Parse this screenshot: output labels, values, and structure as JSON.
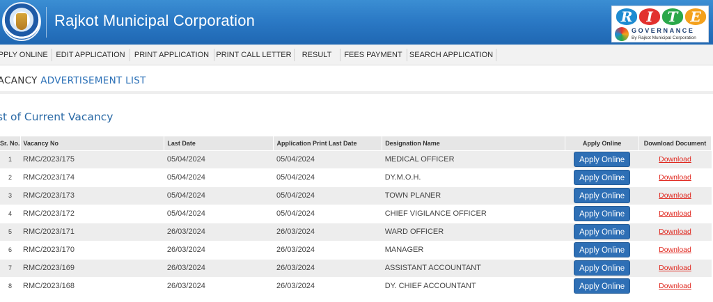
{
  "header": {
    "title": "Rajkot Municipal Corporation",
    "logo_name": "rmc-emblem",
    "rite": {
      "letters": [
        "R",
        "I",
        "T",
        "E"
      ],
      "governance": "GOVERNANCE",
      "by": "By Rajkot Municipal Corporation"
    }
  },
  "nav": {
    "items": [
      "APPLY ONLINE",
      "EDIT APPLICATION",
      "PRINT APPLICATION",
      "PRINT CALL LETTER",
      "RESULT",
      "FEES PAYMENT",
      "SEARCH APPLICATION"
    ]
  },
  "band": {
    "prefix": "VACANCY ",
    "highlight": "ADVERTISEMENT LIST"
  },
  "section_title": "List of Current Vacancy",
  "table": {
    "headers": [
      "Sr. No.",
      "Vacancy No",
      "Last Date",
      "Application Print Last Date",
      "Designation Name",
      "Apply Online",
      "Download Document"
    ],
    "button_label": "Apply Online",
    "download_label": "Download",
    "rows": [
      {
        "sr": "1",
        "vacancy": "RMC/2023/175",
        "last_date": "05/04/2024",
        "print_last_date": "05/04/2024",
        "designation": "MEDICAL OFFICER"
      },
      {
        "sr": "2",
        "vacancy": "RMC/2023/174",
        "last_date": "05/04/2024",
        "print_last_date": "05/04/2024",
        "designation": "DY.M.O.H."
      },
      {
        "sr": "3",
        "vacancy": "RMC/2023/173",
        "last_date": "05/04/2024",
        "print_last_date": "05/04/2024",
        "designation": "TOWN PLANER"
      },
      {
        "sr": "4",
        "vacancy": "RMC/2023/172",
        "last_date": "05/04/2024",
        "print_last_date": "05/04/2024",
        "designation": "CHIEF VIGILANCE OFFICER"
      },
      {
        "sr": "5",
        "vacancy": "RMC/2023/171",
        "last_date": "26/03/2024",
        "print_last_date": "26/03/2024",
        "designation": "WARD OFFICER"
      },
      {
        "sr": "6",
        "vacancy": "RMC/2023/170",
        "last_date": "26/03/2024",
        "print_last_date": "26/03/2024",
        "designation": "MANAGER"
      },
      {
        "sr": "7",
        "vacancy": "RMC/2023/169",
        "last_date": "26/03/2024",
        "print_last_date": "26/03/2024",
        "designation": "ASSISTANT ACCOUNTANT"
      },
      {
        "sr": "8",
        "vacancy": "RMC/2023/168",
        "last_date": "26/03/2024",
        "print_last_date": "26/03/2024",
        "designation": "DY. CHIEF ACCOUNTANT"
      }
    ]
  },
  "colors": {
    "header_blue": "#2a78c4",
    "accent_blue": "#2a6fb6",
    "button_blue": "#2e6fb5",
    "download_red": "#e0281f"
  }
}
